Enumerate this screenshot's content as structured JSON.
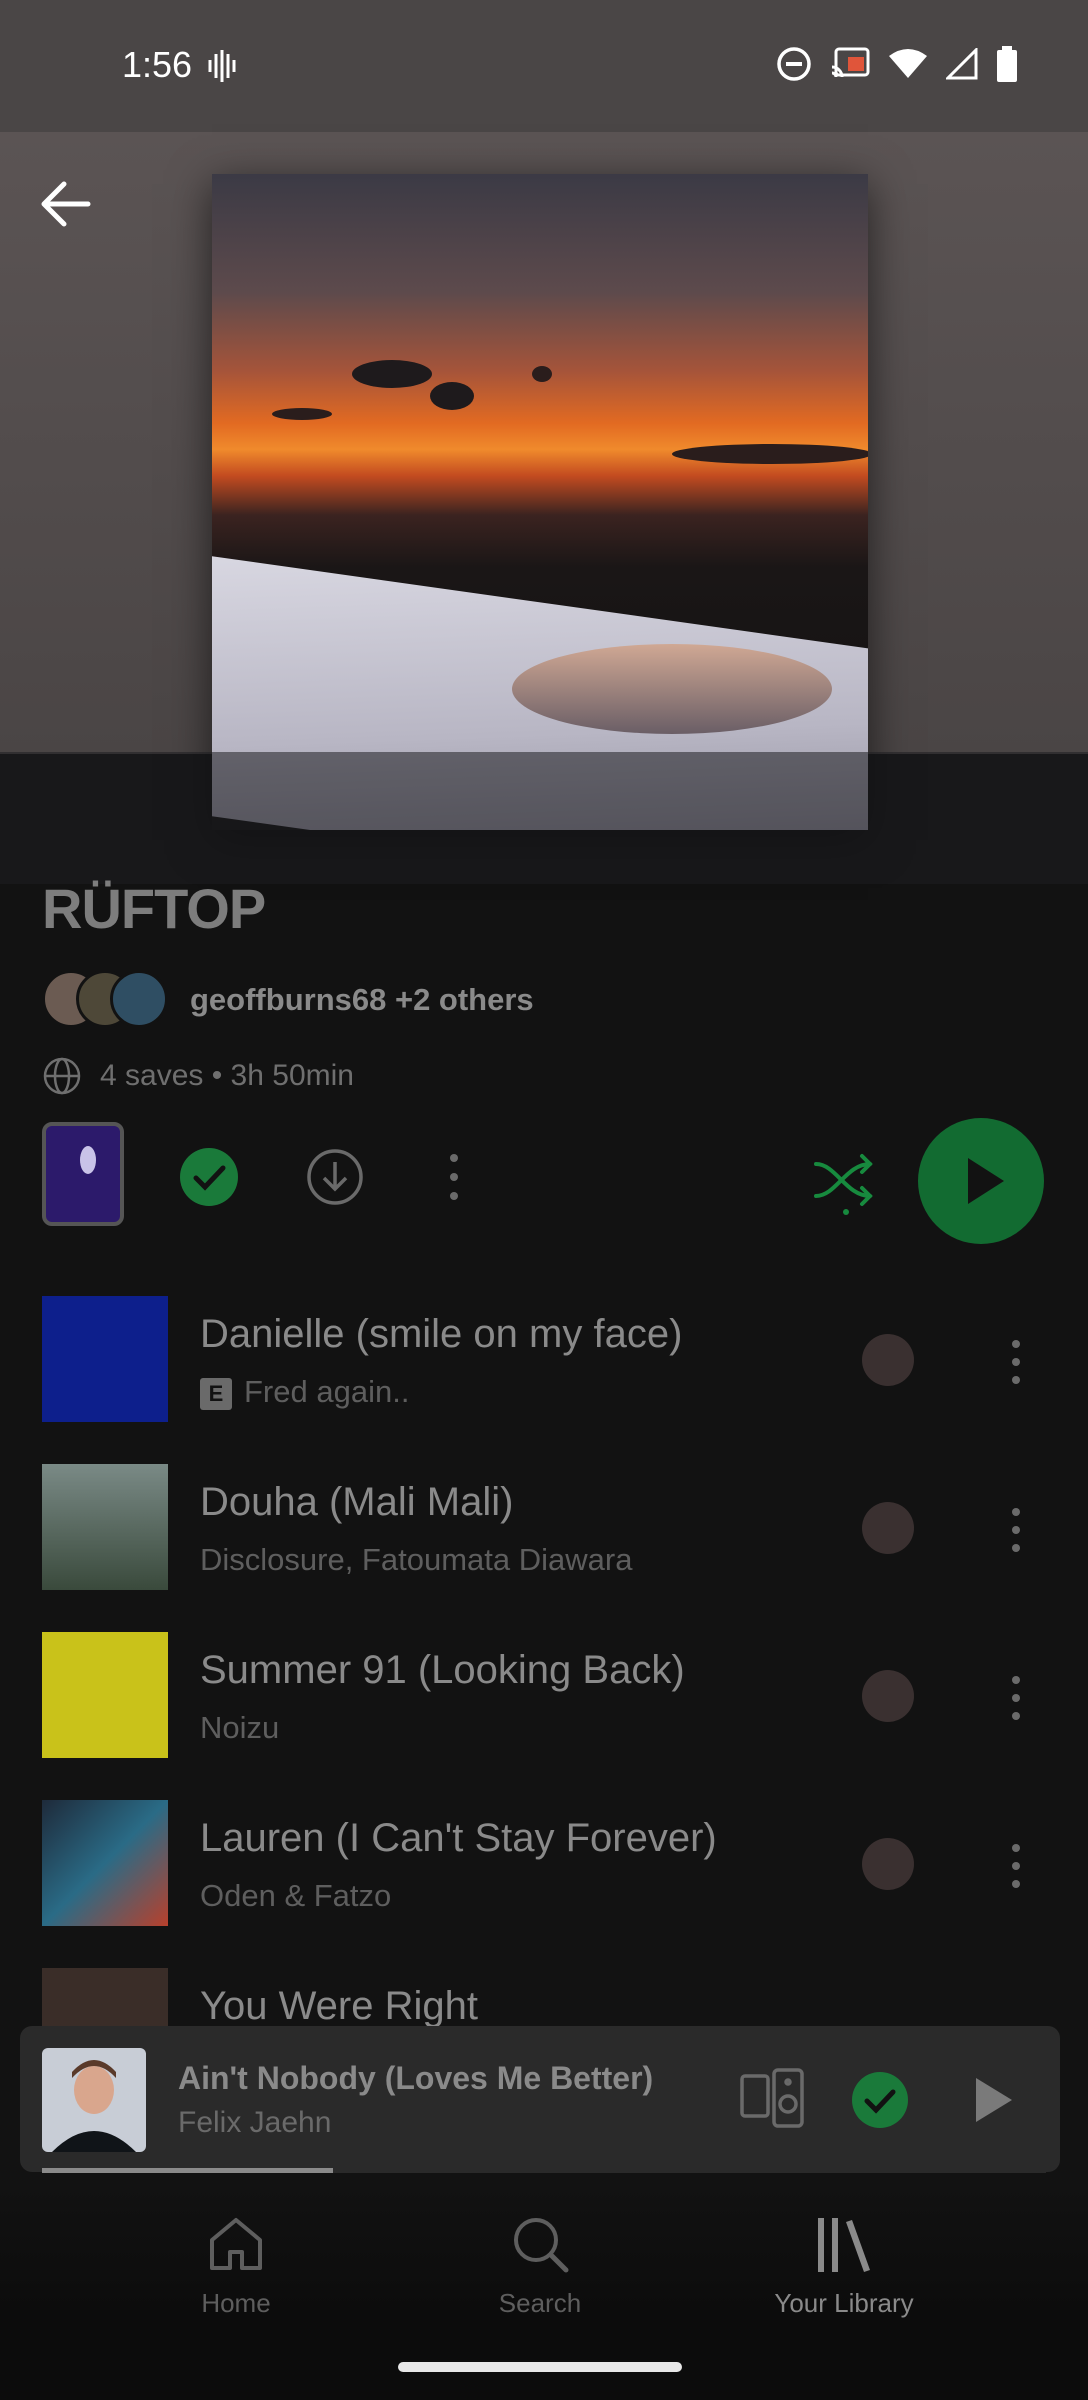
{
  "status_bar": {
    "time": "1:56"
  },
  "playlist": {
    "title": "RÜFTOP",
    "owners": "geoffburns68 +2 others",
    "meta": "4 saves • 3h 50min"
  },
  "tracks": [
    {
      "title": "Danielle (smile on my face)",
      "artist": "Fred again..",
      "explicit_label": "E",
      "art_color": "#0d1f8c"
    },
    {
      "title": "Douha (Mali Mali)",
      "artist": "Disclosure, Fatoumata Diawara",
      "explicit_label": "",
      "art_color": "#5f6b5a"
    },
    {
      "title": "Summer 91 (Looking Back)",
      "artist": "Noizu",
      "explicit_label": "",
      "art_color": "#c9c21a"
    },
    {
      "title": "Lauren (I Can't Stay Forever)",
      "artist": "Oden & Fatzo",
      "explicit_label": "",
      "art_color": "#2a6b86"
    },
    {
      "title": "You Were Right",
      "artist": "",
      "explicit_label": "",
      "art_color": "#3a2d28"
    }
  ],
  "mini_player": {
    "title": "Ain't Nobody (Loves Me Better)",
    "artist": "Felix Jaehn",
    "progress": 0.29
  },
  "bottom_nav": {
    "home": "Home",
    "search": "Search",
    "library": "Your Library"
  },
  "colors": {
    "spotify_green": "#1db954",
    "background": "#121212"
  }
}
